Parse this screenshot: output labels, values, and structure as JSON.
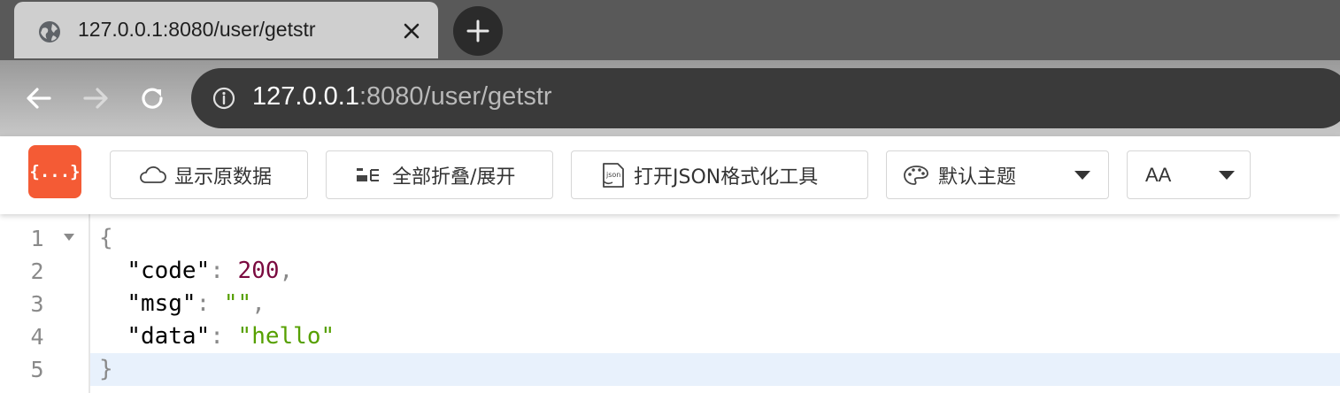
{
  "browser": {
    "tab": {
      "title": "127.0.0.1:8080/user/getstr"
    },
    "address": {
      "host": "127.0.0.1",
      "rest": ":8080/user/getstr"
    }
  },
  "viewer": {
    "logo_text": "{...}",
    "buttons": {
      "raw": "显示原数据",
      "fold": "全部折叠/展开",
      "formatter": "打开JSON格式化工具"
    },
    "theme_select": {
      "value": "默认主题"
    },
    "font_select": {
      "value": "AA"
    }
  },
  "editor": {
    "line_numbers": [
      "1",
      "2",
      "3",
      "4",
      "5"
    ],
    "lines": {
      "open_brace": "{",
      "close_brace": "}",
      "code_key": "\"code\"",
      "code_value": "200",
      "msg_key": "\"msg\"",
      "msg_value": "\"\"",
      "data_key": "\"data\"",
      "data_value": "\"hello\"",
      "colon": ": ",
      "comma": ","
    },
    "active_line": "5"
  },
  "colors": {
    "logo_bg": "#f45b35",
    "number": "#7a0a3f",
    "string": "#56a000",
    "active_line_bg": "#e8f1fc"
  }
}
